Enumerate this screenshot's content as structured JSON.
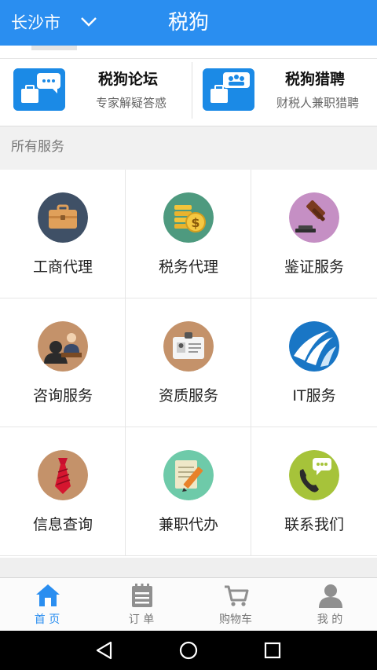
{
  "header": {
    "city": "长沙市",
    "title": "税狗"
  },
  "promos": [
    {
      "name": "税狗论坛",
      "sub": "专家解疑答惑"
    },
    {
      "name": "税狗猎聘",
      "sub": "财税人兼职猎聘"
    }
  ],
  "section_title": "所有服务",
  "services": [
    {
      "label": "工商代理",
      "icon": "briefcase-icon",
      "color": "#3f5066"
    },
    {
      "label": "税务代理",
      "icon": "coins-icon",
      "color": "#4e9a7f"
    },
    {
      "label": "鉴证服务",
      "icon": "gavel-icon",
      "color": "#c58fc4"
    },
    {
      "label": "咨询服务",
      "icon": "consultation-icon",
      "color": "#c4926a"
    },
    {
      "label": "资质服务",
      "icon": "id-card-icon",
      "color": "#c4926a"
    },
    {
      "label": "IT服务",
      "icon": "it-logo-icon",
      "color": "#1976c5"
    },
    {
      "label": "信息查询",
      "icon": "necktie-icon",
      "color": "#c4926a"
    },
    {
      "label": "兼职代办",
      "icon": "notepad-pencil-icon",
      "color": "#6ecaa9"
    },
    {
      "label": "联系我们",
      "icon": "phone-icon",
      "color": "#a6c33a"
    }
  ],
  "tabs": [
    {
      "label": "首 页",
      "icon": "home-icon",
      "active": true
    },
    {
      "label": "订 单",
      "icon": "order-list-icon",
      "active": false
    },
    {
      "label": "购物车",
      "icon": "cart-icon",
      "active": false
    },
    {
      "label": "我 的",
      "icon": "profile-icon",
      "active": false
    }
  ],
  "colors": {
    "brand": "#2a8ef0",
    "tab_active": "#2a8ef0"
  }
}
